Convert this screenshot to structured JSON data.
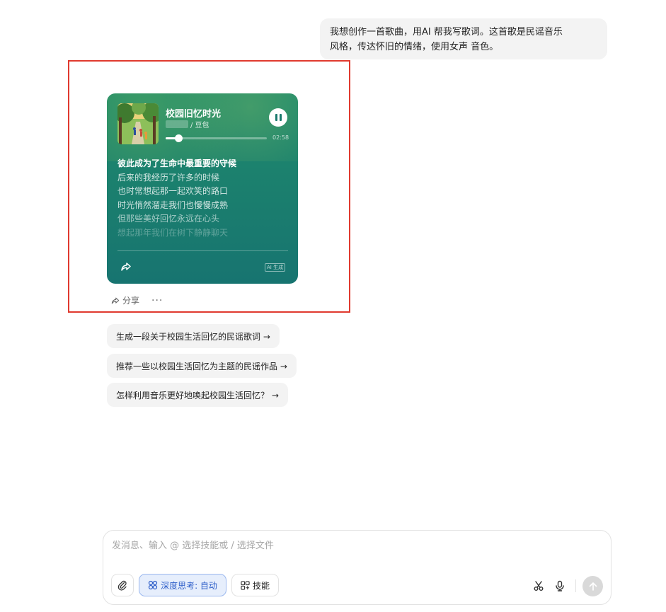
{
  "user_message": {
    "line1": "我想创作一首歌曲，用AI 帮我写歌词。这首歌是民谣音乐",
    "line2": "风格，传达怀旧的情绪，使用女声 音色。"
  },
  "music_card": {
    "title": "校园旧忆时光",
    "artist_suffix": "/ 豆包",
    "duration": "02:58",
    "progress": 0.13,
    "lyrics": [
      "彼此成为了生命中最重要的守候",
      "后来的我经历了许多的时候",
      "也时常想起那一起欢笑的路口",
      "时光悄然溜走我们也慢慢成熟",
      "但那些美好回忆永远在心头",
      "想起那年我们在树下静静聊天"
    ],
    "ai_badge": "AI 生成",
    "colors": {
      "card_top": "#1f8a6c",
      "card_bottom": "#177470"
    }
  },
  "actions": {
    "share_label": "分享",
    "more_label": "···"
  },
  "suggestions": [
    "生成一段关于校园生活回忆的民谣歌词 →",
    "推荐一些以校园生活回忆为主题的民谣作品 →",
    "怎样利用音乐更好地唤起校园生活回忆？ →"
  ],
  "composer": {
    "placeholder": "发消息、输入 @ 选择技能或 / 选择文件",
    "deep_think_label": "深度思考: 自动",
    "skills_label": "技能"
  },
  "highlight_color": "#e03a2f"
}
